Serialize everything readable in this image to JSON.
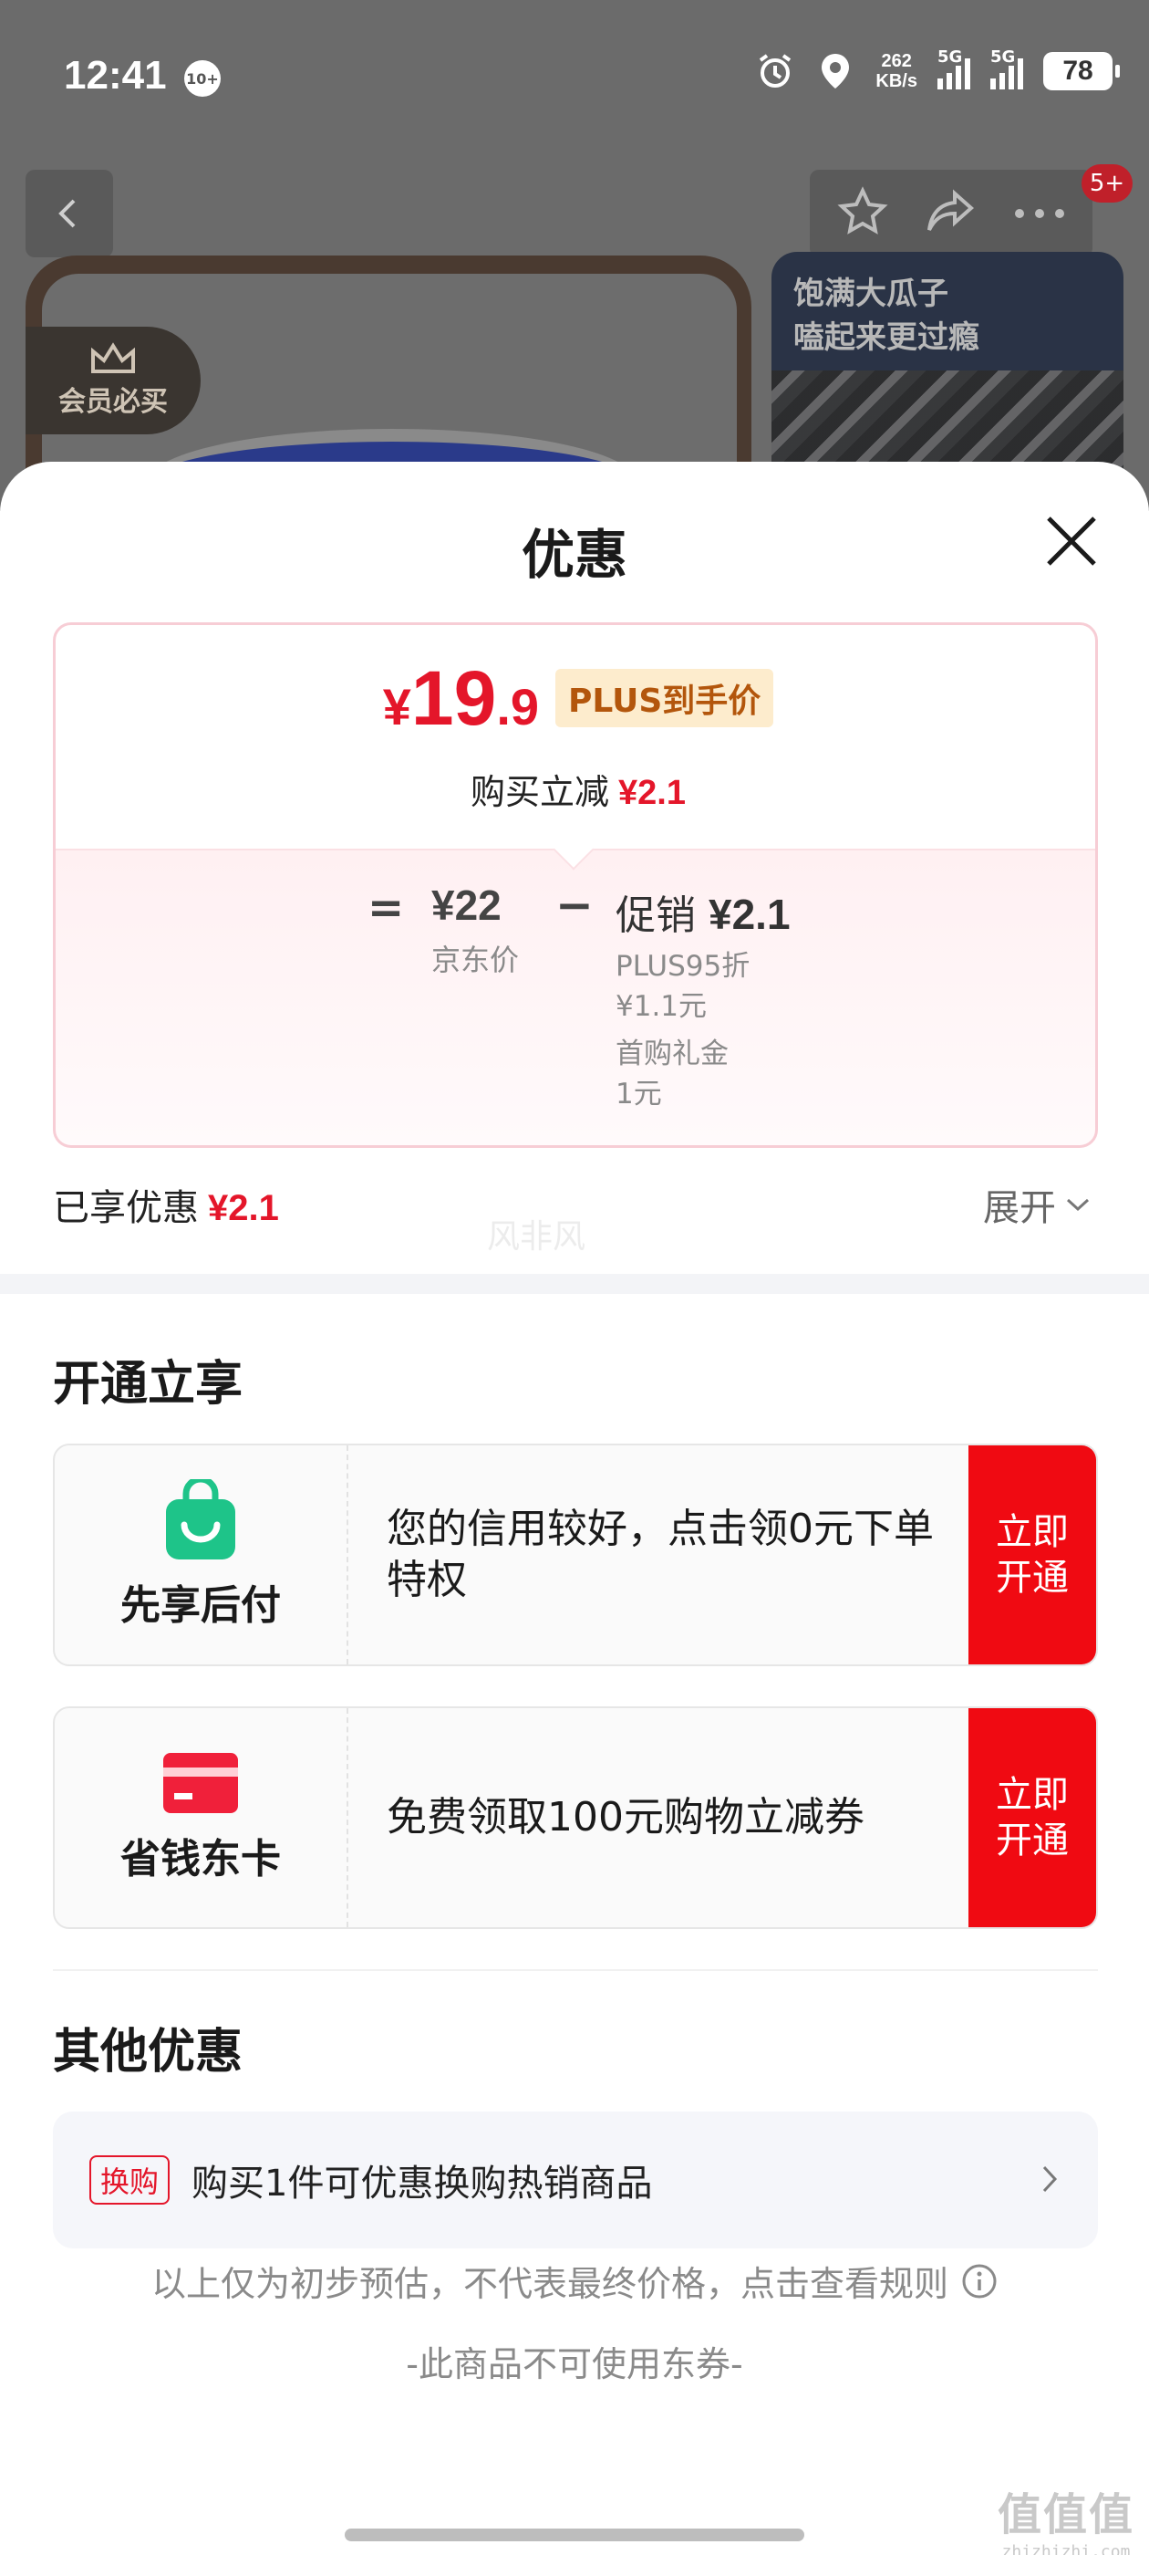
{
  "status_bar": {
    "time": "12:41",
    "notification_badge": "10+",
    "net_speed_value": "262",
    "net_speed_unit": "KB/s",
    "sim1": "5G",
    "sim2": "5G",
    "battery": "78"
  },
  "product_page": {
    "cart_badge": "5+",
    "vip_tag": "会员必买",
    "promo_banner_line1": "饱满大瓜子",
    "promo_banner_line2": "嗑起来更过瘾"
  },
  "sheet": {
    "title": "优惠",
    "price": {
      "currency": "¥",
      "integer": "19",
      "decimal": ".9",
      "plus_tag": "PLUS到手价",
      "reduce_label": "购买立减",
      "reduce_amount": "¥2.1"
    },
    "breakdown": {
      "equals": "=",
      "jd_price": "¥22",
      "jd_label": "京东价",
      "minus": "−",
      "promo_label": "促销",
      "promo_amount": "¥2.1",
      "items": [
        {
          "line1": "PLUS95折",
          "line2": "¥1.1元"
        },
        {
          "line1": "首购礼金",
          "line2": "1元"
        }
      ]
    },
    "enjoyed_label": "已享优惠",
    "enjoyed_amount": "¥2.1",
    "expand_label": "展开",
    "watermark": "风非风",
    "open_section_title": "开通立享",
    "services": [
      {
        "name": "先享后付",
        "icon": "shopping-bag-smile-icon",
        "description": "您的信用较好，点击领0元下单特权",
        "button": "立即开通"
      },
      {
        "name": "省钱东卡",
        "icon": "card-icon",
        "description": "免费领取100元购物立减券",
        "button": "立即开通"
      }
    ],
    "other_section_title": "其他优惠",
    "other_offer": {
      "tag": "换购",
      "text": "购买1件可优惠换购热销商品"
    },
    "disclaimer": "以上仅为初步预估，不代表最终价格，点击查看规则",
    "no_coupon": "-此商品不可使用东券-"
  },
  "corner_logo": {
    "big": "值值值",
    "small": "zhizhizhi.com"
  },
  "colors": {
    "accent_red": "#e4162a",
    "button_red": "#f00a12",
    "green": "#1ec489",
    "plus_tag_bg": "#fdeccd"
  }
}
